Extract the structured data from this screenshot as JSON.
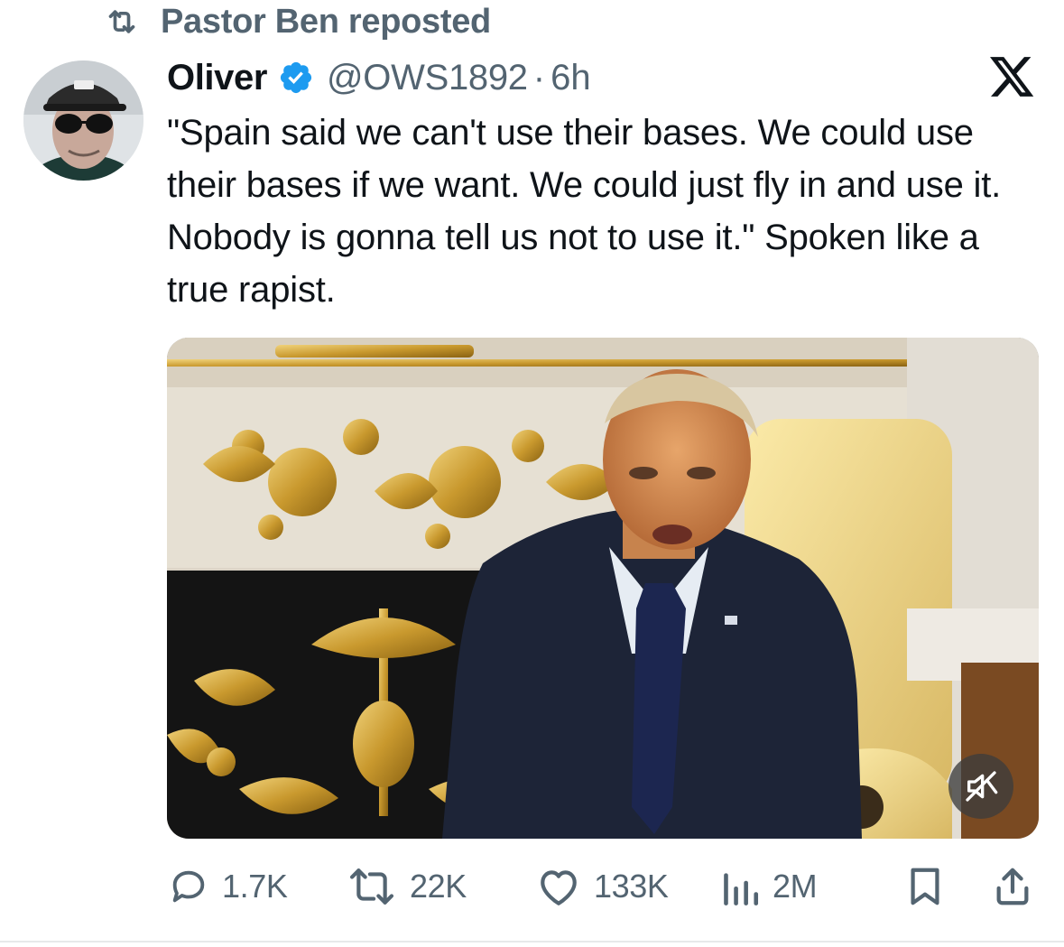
{
  "repost": {
    "icon": "repost-icon",
    "text": "Pastor Ben reposted"
  },
  "author": {
    "avatar": "avatar",
    "display_name": "Oliver",
    "verified_icon": "verified-badge-icon",
    "handle": "@OWS1892",
    "separator": "·",
    "time": "6h"
  },
  "platform_logo": "x-logo-icon",
  "tweet": {
    "text": "\"Spain said we can't use their bases. We could use their bases if we want. We could just fly in and use it. Nobody is gonna tell us not to use it.\" Spoken like a true rapist."
  },
  "media": {
    "type": "video",
    "mute_icon": "speaker-muted-icon"
  },
  "actions": {
    "reply": {
      "icon": "reply-icon",
      "count": "1.7K"
    },
    "repost": {
      "icon": "repost-icon",
      "count": "22K"
    },
    "like": {
      "icon": "heart-icon",
      "count": "133K"
    },
    "views": {
      "icon": "views-chart-icon",
      "count": "2M"
    },
    "bookmark": {
      "icon": "bookmark-icon"
    },
    "share": {
      "icon": "share-icon"
    }
  },
  "colors": {
    "text": "#0f1419",
    "secondary": "#536471",
    "verified": "#1d9bf0"
  }
}
